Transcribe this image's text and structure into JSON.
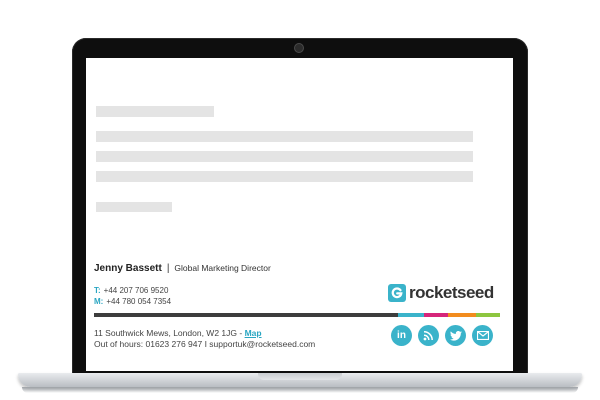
{
  "signature": {
    "name": "Jenny Bassett",
    "separator": "|",
    "job_title": "Global Marketing Director",
    "phone_label": "T:",
    "phone": "+44 207 706 9520",
    "mobile_label": "M:",
    "mobile": "+44 780 054 7354",
    "address": "11 Southwick Mews, London, W2 1JG - ",
    "map_link": "Map",
    "out_of_hours": "Out of hours: 01623 276 947 I supportuk@rocketseed.com"
  },
  "logo": {
    "text": "rocketseed"
  },
  "social_icons": [
    "linkedin-icon",
    "rss-icon",
    "twitter-icon",
    "email-icon"
  ],
  "colors": {
    "accent": "#3ab3ca",
    "bar_dark": "#3d3d3d",
    "bar_teal": "#3ab3ca",
    "bar_magenta": "#d6257a",
    "bar_orange": "#f28c1e",
    "bar_green": "#8dc63f"
  }
}
